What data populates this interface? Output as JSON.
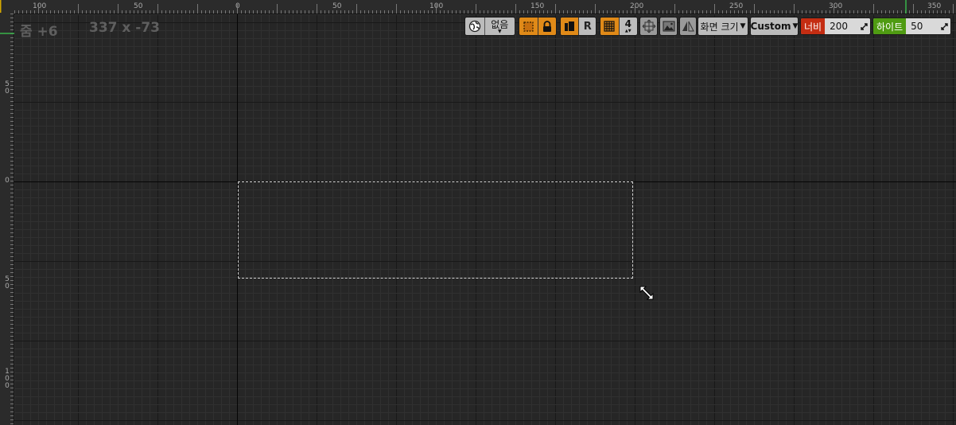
{
  "rulers": {
    "horizontal_ticks": [
      "100",
      "50",
      "0",
      "50",
      "100",
      "150",
      "200",
      "250",
      "300",
      "350"
    ],
    "vertical_ticks": [
      "5 0",
      "0",
      "5 0",
      "1 0 0"
    ]
  },
  "status": {
    "zoom": "줌 +6",
    "cursor": "337 x -73"
  },
  "toolbar": {
    "localization_value": "없음",
    "respect_locks_label": "R",
    "grid_snap_value": "4",
    "screen_size_label": "화면 크기",
    "preset_label": "Custom",
    "width_tag": "너비",
    "width_value": "200",
    "height_tag": "하이트",
    "height_value": "50"
  },
  "colors": {
    "canvas_bg": "#262626",
    "accent_orange": "#e08a18",
    "width_tag_red": "#c42d12",
    "height_tag_green": "#4f9b12",
    "ruler_marker": "#39b54a"
  },
  "icons": [
    "globe-icon",
    "marquee-select-icon",
    "lock-icon",
    "copy-icon",
    "grid-icon",
    "spinner-arrows-icon",
    "move-widget-icon",
    "background-image-icon",
    "mirror-icon",
    "dropdown-arrow-icon",
    "resize-arrows-icon"
  ]
}
